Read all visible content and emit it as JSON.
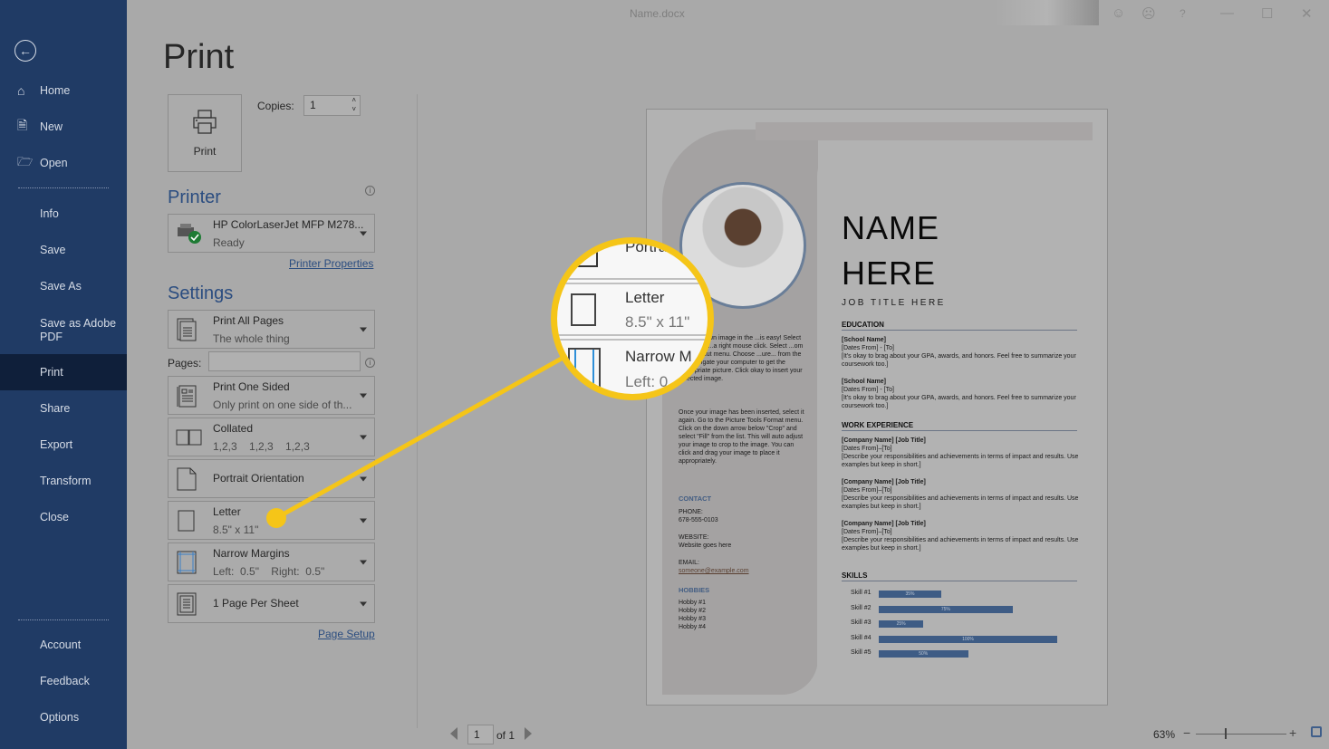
{
  "window": {
    "title": "Name.docx",
    "controls": [
      "smile-icon",
      "frown-icon",
      "help-icon",
      "minimize-icon",
      "maximize-icon",
      "close-icon"
    ]
  },
  "sidebar": {
    "back_icon": "back-arrow-icon",
    "top_items": [
      {
        "label": "Home",
        "icon": "home-icon"
      },
      {
        "label": "New",
        "icon": "new-document-icon"
      },
      {
        "label": "Open",
        "icon": "folder-open-icon"
      }
    ],
    "items": [
      "Info",
      "Save",
      "Save As",
      "Save as Adobe PDF",
      "Print",
      "Share",
      "Export",
      "Transform",
      "Close"
    ],
    "active": "Print",
    "bottom_items": [
      "Account",
      "Feedback",
      "Options"
    ]
  },
  "print": {
    "title": "Print",
    "print_button": "Print",
    "copies_label": "Copies:",
    "copies_value": "1",
    "printer_heading": "Printer",
    "printer_name": "HP ColorLaserJet MFP M278...",
    "printer_status": "Ready",
    "printer_properties": "Printer Properties",
    "settings_heading": "Settings",
    "settings": [
      {
        "title": "Print All Pages",
        "subtitle": "The whole thing",
        "icon": "pages-icon"
      },
      {
        "title": "Print One Sided",
        "subtitle": "Only print on one side of th...",
        "icon": "one-sided-icon"
      },
      {
        "title": "Collated",
        "subtitle": "1,2,3    1,2,3    1,2,3",
        "icon": "collated-icon"
      },
      {
        "title": "Portrait Orientation",
        "subtitle": "",
        "icon": "portrait-icon"
      },
      {
        "title": "Letter",
        "subtitle": "8.5\" x 11\"",
        "icon": "paper-size-icon"
      },
      {
        "title": "Narrow Margins",
        "subtitle": "Left:  0.5\"    Right:  0.5\"",
        "icon": "margins-icon"
      },
      {
        "title": "1 Page Per Sheet",
        "subtitle": "",
        "icon": "pages-per-sheet-icon"
      }
    ],
    "pages_label": "Pages:",
    "pages_value": "",
    "page_setup": "Page Setup"
  },
  "magnifier": {
    "top": "Portrait",
    "title": "Letter",
    "subtitle": "8.5\" x 11\"",
    "next": "Narrow M",
    "next_sub": "Left:  0"
  },
  "preview": {
    "name1": "NAME",
    "name2": "HERE",
    "job_title": "JOB TITLE HERE",
    "left_text1": "...ut your own image in the ...is easy! Select the image ...a right mouse click. Select ...om the shortcut menu. Choose ...ure... from the list. Navigate your computer to get the appropriate picture. Click okay to insert your selected image.",
    "left_text2": "Once your image has been inserted, select it again. Go to the Picture Tools Format menu. Click on the down arrow below \"Crop\" and select \"Fill\" from the list. This will auto adjust your image to crop to the image. You can click and drag your image to place it appropriately.",
    "contact_heading": "CONTACT",
    "phone_label": "PHONE:",
    "phone": "678-555-0103",
    "website_label": "WEBSITE:",
    "website": "Website goes here",
    "email_label": "EMAIL:",
    "email": "someone@example.com",
    "hobbies_heading": "HOBBIES",
    "hobbies": [
      "Hobby #1",
      "Hobby #2",
      "Hobby #3",
      "Hobby #4"
    ],
    "education_heading": "EDUCATION",
    "education": [
      {
        "name": "[School Name]",
        "dates": "[Dates From] - [To]",
        "desc": "[It's okay to brag about your GPA, awards, and honors. Feel free to summarize your coursework too.]"
      },
      {
        "name": "[School Name]",
        "dates": "[Dates From] - [To]",
        "desc": "[It's okay to brag about your GPA, awards, and honors. Feel free to summarize your coursework too.]"
      }
    ],
    "work_heading": "WORK EXPERIENCE",
    "work": [
      {
        "name": "[Company Name]  [Job Title]",
        "dates": "[Dates From]–[To]",
        "desc": "[Describe your responsibilities and achievements in terms of impact and results. Use examples but keep in short.]"
      },
      {
        "name": "[Company Name]  [Job Title]",
        "dates": "[Dates From]–[To]",
        "desc": "[Describe your responsibilities and achievements in terms of impact and results. Use examples but keep in short.]"
      },
      {
        "name": "[Company Name]  [Job Title]",
        "dates": "[Dates From]–[To]",
        "desc": "[Describe your responsibilities and achievements in terms of impact and results. Use examples but keep in short.]"
      }
    ],
    "skills_heading": "SKILLS",
    "skills": [
      {
        "label": "Skill #1",
        "pct": 35,
        "text": "35%"
      },
      {
        "label": "Skill #2",
        "pct": 75,
        "text": "75%"
      },
      {
        "label": "Skill #3",
        "pct": 25,
        "text": "25%"
      },
      {
        "label": "Skill #4",
        "pct": 100,
        "text": "100%"
      },
      {
        "label": "Skill #5",
        "pct": 50,
        "text": "50%"
      }
    ]
  },
  "footer": {
    "page_value": "1",
    "of_label": "of 1",
    "zoom": "63%",
    "zoom_minus": "−",
    "zoom_plus": "+"
  },
  "colors": {
    "sidebar": "#203b65",
    "accent": "#2b4d80",
    "highlight": "#f5c518"
  }
}
